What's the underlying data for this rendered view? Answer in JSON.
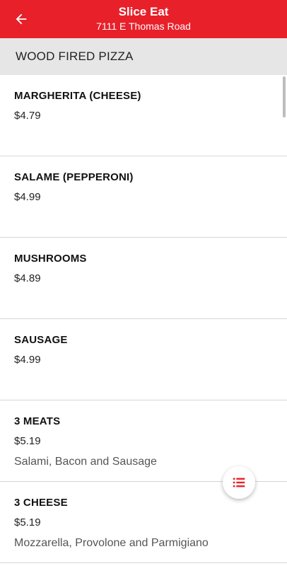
{
  "header": {
    "title": "Slice Eat",
    "subtitle": "7111 E Thomas Road",
    "back_icon": "arrow-left-icon",
    "bg_color": "#e8202a"
  },
  "section": {
    "title": "WOOD FIRED PIZZA"
  },
  "items": [
    {
      "name": "MARGHERITA (CHEESE)",
      "price": "$4.79",
      "description": ""
    },
    {
      "name": "SALAME (PEPPERONI)",
      "price": "$4.99",
      "description": ""
    },
    {
      "name": "MUSHROOMS",
      "price": "$4.89",
      "description": ""
    },
    {
      "name": "SAUSAGE",
      "price": "$4.99",
      "description": ""
    },
    {
      "name": "3 MEATS",
      "price": "$5.19",
      "description": "Salami, Bacon and Sausage"
    },
    {
      "name": "3 CHEESE",
      "price": "$5.19",
      "description": "Mozzarella, Provolone and Parmigiano"
    }
  ],
  "fab": {
    "icon": "list-icon",
    "color": "#e8202a"
  }
}
